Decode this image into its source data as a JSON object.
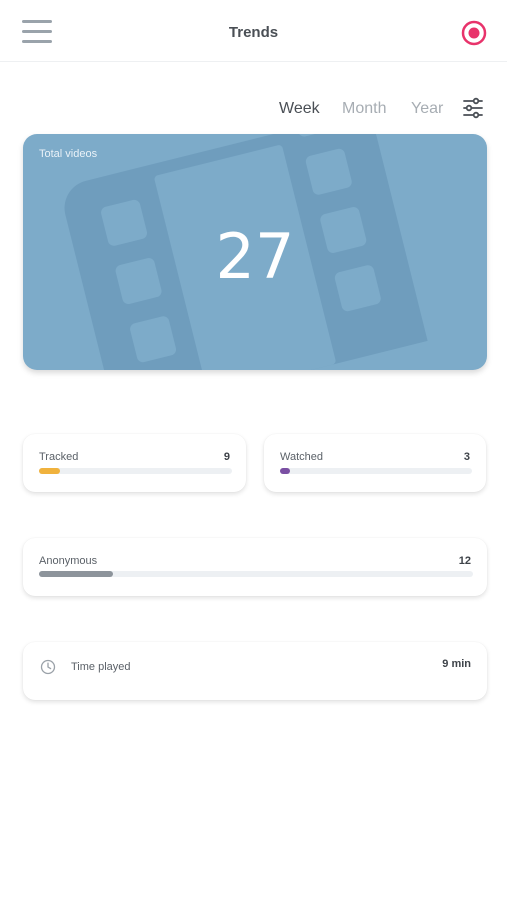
{
  "header": {
    "title": "Trends",
    "menu_icon": "hamburger-icon",
    "record_icon": "record-icon",
    "record_color": "#e8336b"
  },
  "period_tabs": {
    "week": "Week",
    "month": "Month",
    "year": "Year",
    "selected": "Week",
    "filter_icon": "sliders-icon"
  },
  "hero": {
    "label": "Total videos",
    "value": "27",
    "background_color": "#7dabc9",
    "icon": "film-icon"
  },
  "stats": {
    "tracked": {
      "label": "Tracked",
      "value": "9",
      "fraction": 0.11,
      "color": "#f0b23d"
    },
    "watched": {
      "label": "Watched",
      "value": "3",
      "fraction": 0.05,
      "color": "#7a4fa3"
    },
    "anonymous": {
      "label": "Anonymous",
      "value": "12",
      "fraction": 0.17,
      "color": "#8d949b"
    }
  },
  "time_played": {
    "label": "Time played",
    "value": "9 min",
    "icon": "clock-icon"
  }
}
